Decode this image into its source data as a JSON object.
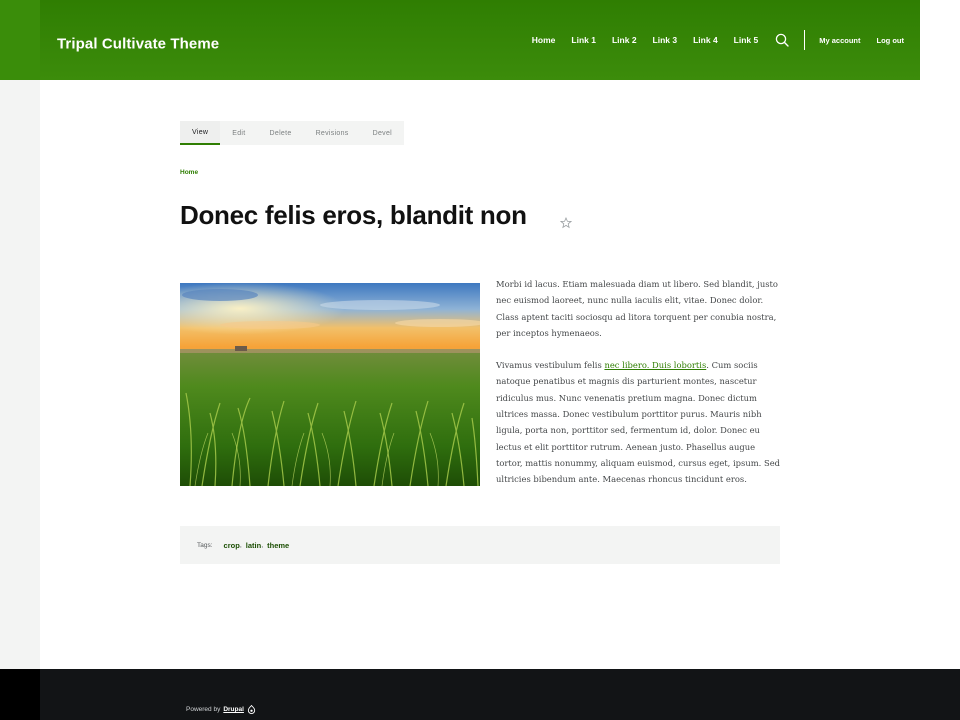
{
  "header": {
    "site_title": "Tripal Cultivate Theme",
    "nav": [
      "Home",
      "Link 1",
      "Link 2",
      "Link 3",
      "Link 4",
      "Link 5"
    ],
    "my_account": "My account",
    "log_out": "Log out"
  },
  "tabs": [
    "View",
    "Edit",
    "Delete",
    "Revisions",
    "Devel"
  ],
  "breadcrumb": "Home",
  "title": "Donec felis eros, blandit non",
  "body": {
    "p1": "Morbi id lacus. Etiam malesuada diam ut libero. Sed blandit, justo nec euismod laoreet, nunc nulla iaculis elit, vitae. Donec dolor. Class aptent taciti sociosqu ad litora torquent per conubia nostra, per inceptos hymenaeos.",
    "p2_before": "Vivamus vestibulum felis ",
    "p2_link": "nec libero. Duis lobortis",
    "p2_after": ". Cum sociis natoque penatibus et magnis dis parturient montes, nascetur ridiculus mus. Nunc venenatis pretium magna. Donec dictum ultrices massa. Donec vestibulum porttitor purus. Mauris nibh ligula, porta non, porttitor sed, fermentum id, dolor. Donec eu lectus et elit porttitor rutrum. Aenean justo. Phasellus augue tortor, mattis nonummy, aliquam euismod, cursus eget, ipsum. Sed ultricies bibendum ante. Maecenas rhoncus tincidunt eros."
  },
  "tags": {
    "label": "Tags:",
    "items": [
      "crop",
      "latin",
      "theme"
    ],
    "separator": ","
  },
  "footer": {
    "powered_by": "Powered by",
    "drupal": "Drupal"
  },
  "colors": {
    "header_green": "#2f7e02",
    "footer_dark": "#121416",
    "link_green": "#2f7e02"
  },
  "icons": [
    "search-icon",
    "star-icon",
    "drupal-icon"
  ]
}
